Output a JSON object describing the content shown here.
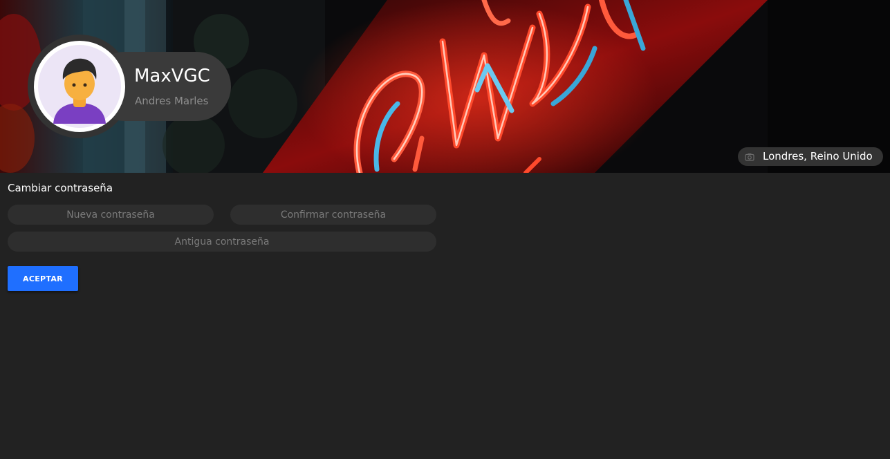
{
  "profile": {
    "username": "MaxVGC",
    "full_name": "Andres Marles",
    "avatar_icon": "user-avatar-icon"
  },
  "banner": {
    "location": "Londres, Reino Unido",
    "location_icon": "camera-icon"
  },
  "password_form": {
    "title": "Cambiar contraseña",
    "new_password_placeholder": "Nueva contraseña",
    "confirm_password_placeholder": "Confirmar contraseña",
    "old_password_placeholder": "Antigua contraseña",
    "accept_label": "ACEPTAR"
  },
  "colors": {
    "background": "#222222",
    "field_background": "#2e2e2e",
    "accent": "#1f6fff",
    "muted_text": "#8d8d8d"
  }
}
